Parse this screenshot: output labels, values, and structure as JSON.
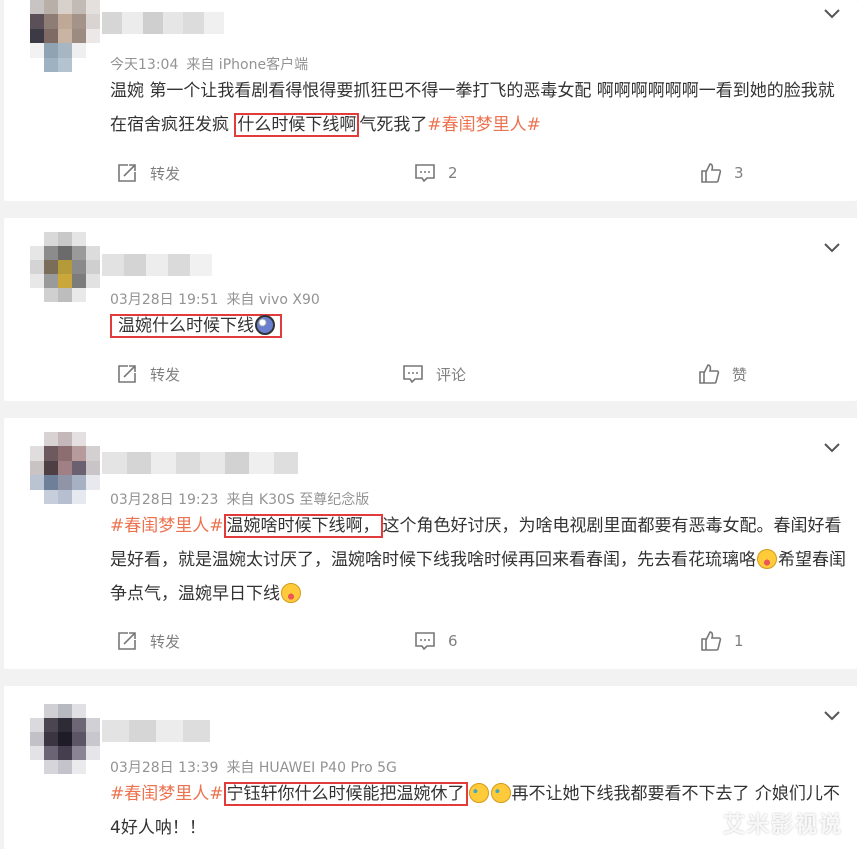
{
  "colors": {
    "topic_tag": "#eb7350",
    "highlight_box": "#e23b3b",
    "meta_text": "#939393"
  },
  "posts": [
    {
      "time": "今天13:04",
      "source": "来自 iPhone客户端",
      "content": {
        "p1": "温婉 第一个让我看剧看得恨得要抓狂巴不得一拳打飞的恶毒女配 啊啊啊啊啊啊一看到她的脸我就在宿舍疯狂发疯 ",
        "hl": "什么时候下线啊",
        "p2": "气死我了",
        "tag": "#春闺梦里人#"
      },
      "actions": {
        "repost": "转发",
        "comment": "2",
        "like": "3"
      }
    },
    {
      "time": "03月28日 19:51",
      "source": "来自 vivo X90",
      "content": {
        "hl": "温婉什么时候下线"
      },
      "actions": {
        "repost": "转发",
        "comment": "评论",
        "like": "赞"
      }
    },
    {
      "time": "03月28日 19:23",
      "source": "来自 K30S 至尊纪念版",
      "content": {
        "tag": "#春闺梦里人#",
        "hl": "温婉啥时候下线啊，",
        "p1": "这个角色好讨厌，为啥电视剧里面都要有恶毒女配。春闺好看是好看，就是温婉太讨厌了，温婉啥时候下线我啥时候再回来看春闺，先去看花琉璃咯",
        "p2": "希望春闺争点气，温婉早日下线"
      },
      "actions": {
        "repost": "转发",
        "comment": "6",
        "like": "1"
      }
    },
    {
      "time": "03月28日 13:39",
      "source": "来自 HUAWEI P40 Pro 5G",
      "content": {
        "tag": "#春闺梦里人#",
        "hl": "宁钰轩你什么时候能把温婉休了",
        "p1": "再不让她下线我都要看不下去了 介娘们儿不4好人呐！！"
      },
      "actions": {}
    }
  ],
  "watermark": "艾米影视说"
}
